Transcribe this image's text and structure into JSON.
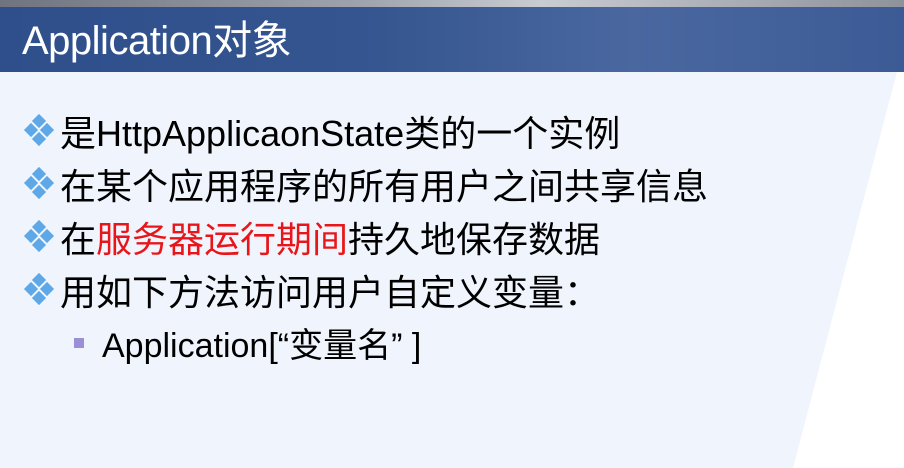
{
  "slide": {
    "title": "Application对象",
    "bullets": [
      {
        "text": "是HttpApplicaonState类的一个实例"
      },
      {
        "text": "在某个应用程序的所有用户之间共享信息"
      },
      {
        "before": "在",
        "highlight": "服务器运行期间",
        "after": "持久地保存数据"
      },
      {
        "text": "用如下方法访问用户自定义变量："
      }
    ],
    "sub_bullet": "Application[“变量名” ]",
    "colors": {
      "header": "#34558f",
      "highlight": "#e8161a",
      "bullet": "#5ea8e8",
      "sub_bullet": "#9b8fd6",
      "panel": "#f0f5fd"
    },
    "icons": {
      "bullet": "four-diamond-icon",
      "sub_bullet": "square-icon"
    }
  }
}
